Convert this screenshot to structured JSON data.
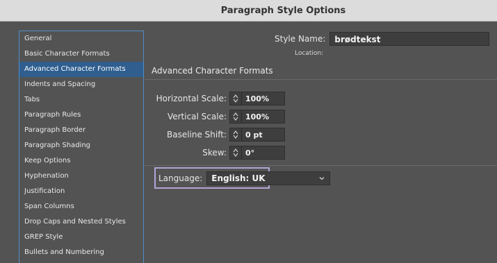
{
  "window": {
    "title": "Paragraph Style Options"
  },
  "sidebar": {
    "items": [
      {
        "label": "General"
      },
      {
        "label": "Basic Character Formats"
      },
      {
        "label": "Advanced Character Formats",
        "selected": true
      },
      {
        "label": "Indents and Spacing"
      },
      {
        "label": "Tabs"
      },
      {
        "label": "Paragraph Rules"
      },
      {
        "label": "Paragraph Border"
      },
      {
        "label": "Paragraph Shading"
      },
      {
        "label": "Keep Options"
      },
      {
        "label": "Hyphenation"
      },
      {
        "label": "Justification"
      },
      {
        "label": "Span Columns"
      },
      {
        "label": "Drop Caps and Nested Styles"
      },
      {
        "label": "GREP Style"
      },
      {
        "label": "Bullets and Numbering"
      }
    ]
  },
  "style_name": {
    "label": "Style Name:",
    "value": "brødtekst"
  },
  "location": {
    "label": "Location:"
  },
  "section": {
    "heading": "Advanced Character Formats"
  },
  "fields": {
    "horizontal_scale": {
      "label": "Horizontal Scale:",
      "value": "100%"
    },
    "vertical_scale": {
      "label": "Vertical Scale:",
      "value": "100%"
    },
    "baseline_shift": {
      "label": "Baseline Shift:",
      "value": "0 pt"
    },
    "skew": {
      "label": "Skew:",
      "value": "0°"
    }
  },
  "language": {
    "label": "Language:",
    "value": "English: UK"
  },
  "colors": {
    "selection": "#2f5e8f",
    "sidebar_border": "#4f8fc8",
    "language_highlight": "#b3a4d6"
  }
}
